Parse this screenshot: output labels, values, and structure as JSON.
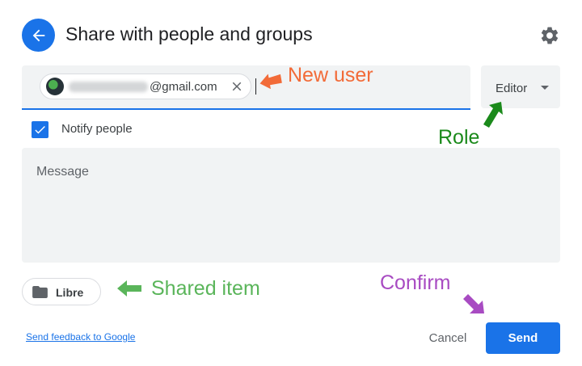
{
  "dialog": {
    "title": "Share with people and groups",
    "back_icon": "arrow-left-icon",
    "settings_icon": "gear-icon"
  },
  "recipient": {
    "chip_email_visible": "@gmail.com",
    "remove_icon": "close-icon"
  },
  "role": {
    "selected": "Editor"
  },
  "notify": {
    "checked": true,
    "label": "Notify people"
  },
  "message": {
    "placeholder": "Message"
  },
  "shared_item": {
    "name": "Libre",
    "icon": "folder-icon"
  },
  "footer": {
    "feedback_link": "Send feedback to Google",
    "cancel_label": "Cancel",
    "send_label": "Send"
  },
  "annotations": {
    "new_user": "New user",
    "role": "Role",
    "shared_item": "Shared item",
    "confirm": "Confirm"
  },
  "colors": {
    "accent": "#1a73e8",
    "field_bg": "#f1f3f4",
    "annotation_orange": "#f26b38",
    "annotation_green_dark": "#1b8a1b",
    "annotation_green_light": "#5ab55a",
    "annotation_purple": "#a84bc2"
  }
}
